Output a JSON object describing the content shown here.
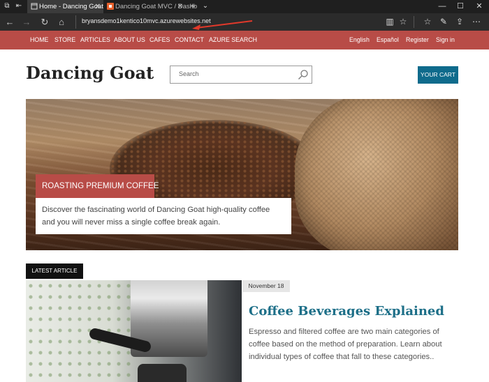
{
  "browser": {
    "tabs": [
      {
        "label": "Home - Dancing Goat",
        "active": true
      },
      {
        "label": "Dancing Goat MVC / Dashb",
        "active": false
      }
    ],
    "url": "bryansdemo1kentico10mvc.azurewebsites.net",
    "accent": "#e1392b"
  },
  "site_nav": {
    "left": [
      "HOME",
      "STORE",
      "ARTICLES",
      "ABOUT US",
      "CAFES",
      "CONTACT",
      "AZURE SEARCH"
    ],
    "right": [
      "English",
      "Español",
      "Register",
      "Sign in"
    ],
    "color": "#b84c47"
  },
  "header": {
    "logo": "Dancing Goat",
    "search_placeholder": "Search",
    "cart_label": "YOUR CART",
    "cart_color": "#0f6b8c"
  },
  "hero": {
    "tag": "ROASTING PREMIUM COFFEE",
    "text": "Discover the fascinating world of Dancing Goat high-quality coffee and you will never miss a single coffee break again."
  },
  "latest": {
    "label": "LATEST ARTICLE",
    "date": "November 18",
    "title": "Coffee Beverages Explained",
    "summary": "Espresso and filtered coffee are two main categories of coffee based on the method of preparation. Learn about individual types of coffee that fall to these categories.."
  }
}
